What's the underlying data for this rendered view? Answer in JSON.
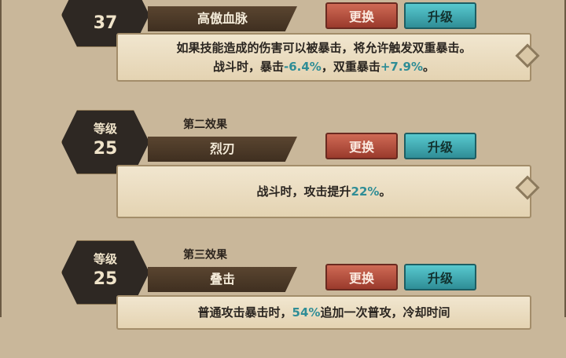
{
  "cards": [
    {
      "level_label": "",
      "level": "37",
      "effect_label": "",
      "name": "高傲血脉",
      "swap_label": "更换",
      "upgrade_label": "升级",
      "desc": [
        {
          "pre": "如果技能造成的伤害可以被暴击，将允许触发双重暴击。",
          "val": "",
          "post": ""
        },
        {
          "pre": "战斗时，暴击",
          "val": "-6.4%",
          "mid": "，双重暴击",
          "val2": "+7.9%",
          "post": "。"
        }
      ]
    },
    {
      "level_label": "等级",
      "level": "25",
      "effect_label": "第二效果",
      "name": "烈刃",
      "swap_label": "更换",
      "upgrade_label": "升级",
      "desc": [
        {
          "pre": "战斗时，攻击提升",
          "val": "22%",
          "post": "。"
        }
      ]
    },
    {
      "level_label": "等级",
      "level": "25",
      "effect_label": "第三效果",
      "name": "叠击",
      "swap_label": "更换",
      "upgrade_label": "升级",
      "desc": [
        {
          "pre": "普通攻击暴击时，",
          "val": "54%",
          "post": "追加一次普攻，冷却时间"
        }
      ]
    }
  ]
}
